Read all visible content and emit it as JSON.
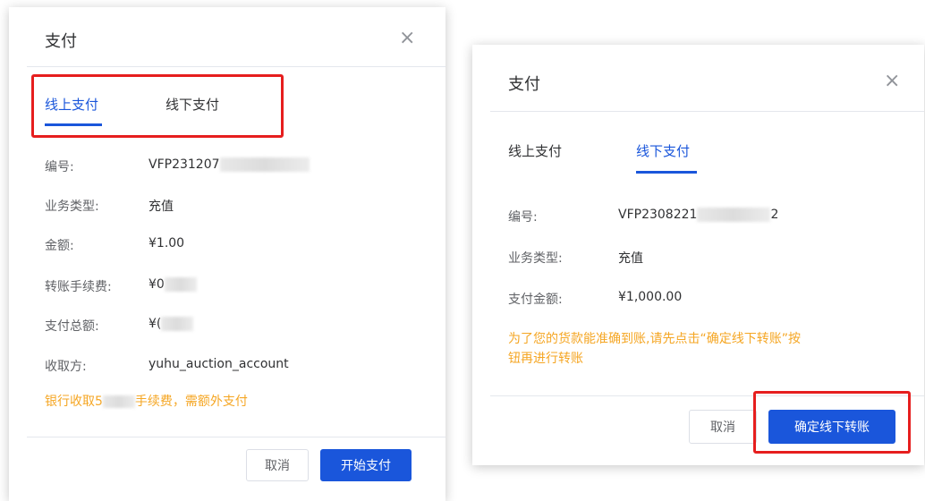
{
  "left_dialog": {
    "title": "支付",
    "close_glyph": "×",
    "tabs": [
      {
        "label": "线上支付",
        "active": true
      },
      {
        "label": "线下支付",
        "active": false
      }
    ],
    "fields": [
      {
        "label": "编号:",
        "value": "VFP231207"
      },
      {
        "label": "业务类型:",
        "value": "充值"
      },
      {
        "label": "金额:",
        "value": "¥1.00"
      },
      {
        "label": "转账手续费:",
        "value": "¥0"
      },
      {
        "label": "支付总额:",
        "value": "¥("
      },
      {
        "label": "收取方:",
        "value": "yuhu_auction_account"
      }
    ],
    "note_prefix": "银行收取5",
    "note_suffix": "手续费，需额外支付",
    "buttons": {
      "cancel": "取消",
      "confirm": "开始支付"
    }
  },
  "right_dialog": {
    "title": "支付",
    "close_glyph": "×",
    "tabs": [
      {
        "label": "线上支付",
        "active": false
      },
      {
        "label": "线下支付",
        "active": true
      }
    ],
    "fields": [
      {
        "label": "编号:",
        "value": "VFP2308221",
        "value_suffix": "2"
      },
      {
        "label": "业务类型:",
        "value": "充值"
      },
      {
        "label": "支付金额:",
        "value": "¥1,000.00"
      }
    ],
    "note_line1": "为了您的货款能准确到账,请先点击“确定线下转账”按",
    "note_line2": "钮再进行转账",
    "buttons": {
      "cancel": "取消",
      "confirm": "确定线下转账"
    }
  },
  "colors": {
    "primary": "#1a56db",
    "warning": "#f5a623",
    "highlight": "#e61e1e"
  }
}
